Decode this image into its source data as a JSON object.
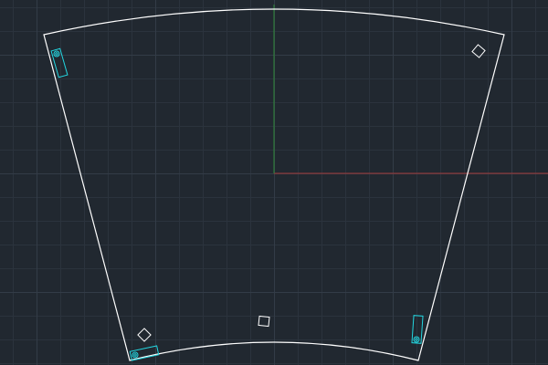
{
  "viewport": {
    "background_color": "#212830",
    "grid_minor_color": "#2b333d",
    "grid_major_color": "#333c47"
  },
  "axes": {
    "x_axis_color": "#a33a3a",
    "y_axis_color": "#2f8a3a"
  },
  "drawing": {
    "outline_color": "#ffffff",
    "slot_color": "#23d6e0",
    "marker_color": "#ffffff"
  }
}
